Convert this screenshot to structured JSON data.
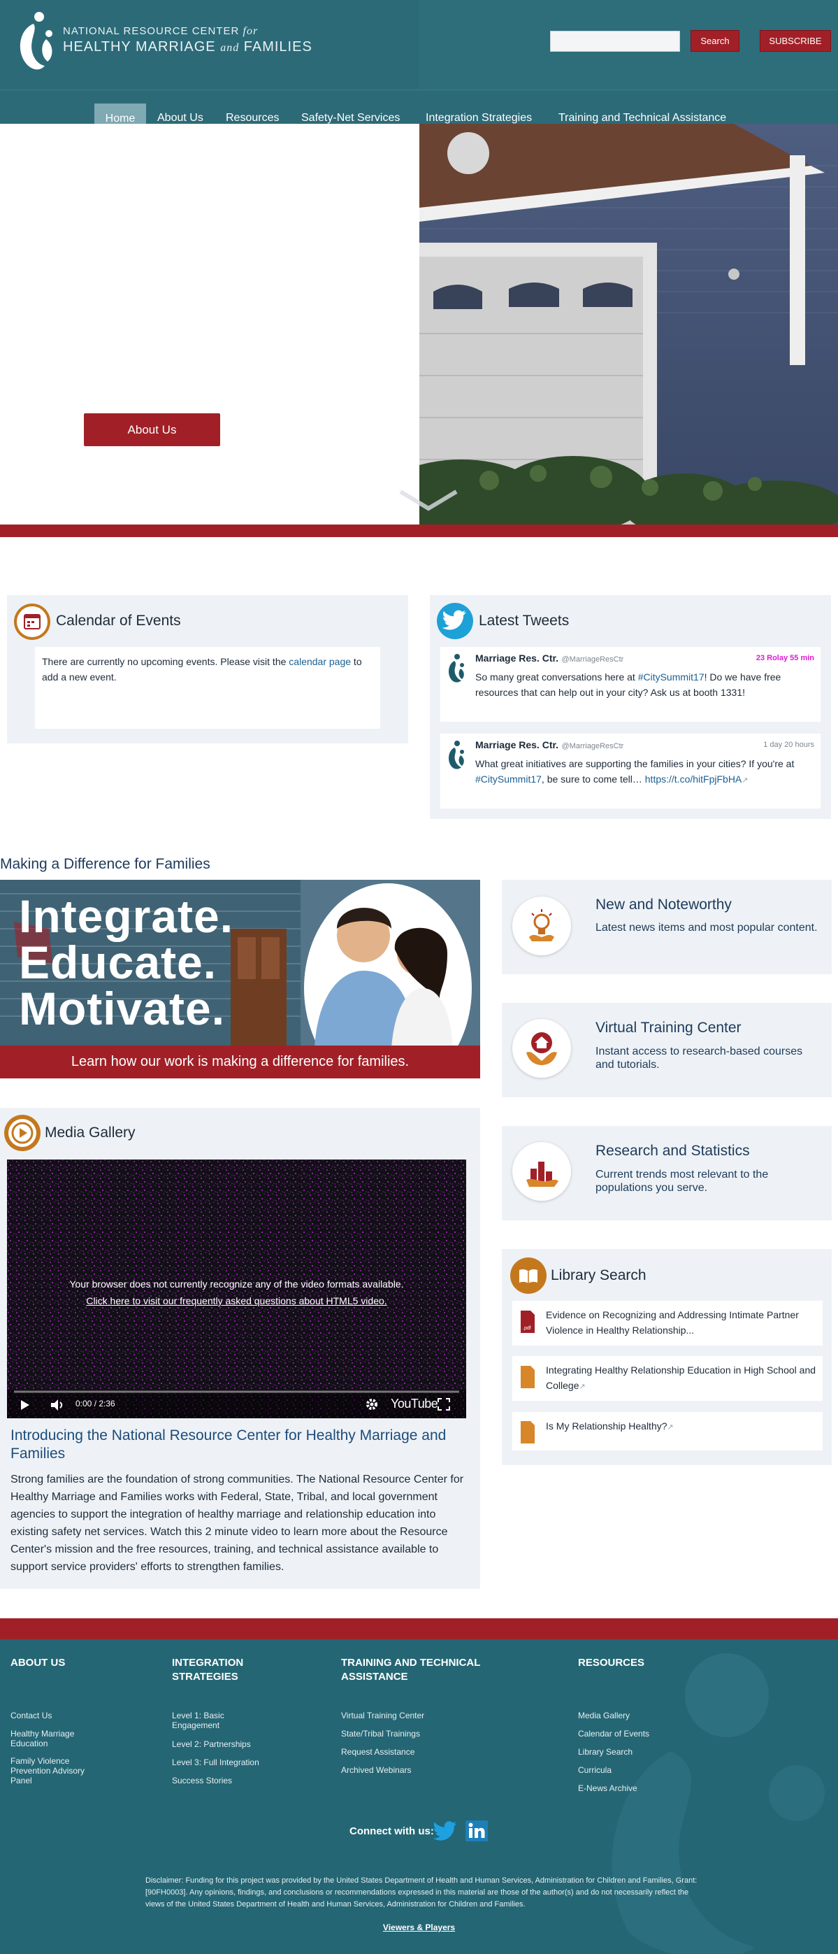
{
  "header": {
    "logo_line1": "NATIONAL RESOURCE CENTER ",
    "logo_for": "for",
    "logo_line2a": "HEALTHY MARRIAGE ",
    "logo_and": "and",
    "logo_line2b": " FAMILIES",
    "search_button": "Search",
    "subscribe_button": "SUBSCRIBE"
  },
  "nav": {
    "items": [
      "Home",
      "About Us",
      "Resources",
      "Safety-Net Services",
      "Integration Strategies",
      "Training and Technical Assistance"
    ]
  },
  "hero": {
    "button": "About Us"
  },
  "events": {
    "title": "Calendar of Events",
    "text_before": "There are currently no upcoming events. Please visit the ",
    "link": "calendar page",
    "text_after": " to add a new event."
  },
  "tweets": {
    "title": "Latest Tweets",
    "items": [
      {
        "name": "Marriage Res. Ctr.",
        "handle": "@MarriageResCtr",
        "time": "23 Rolay 55 min",
        "body_before": "So many great conversations here at ",
        "hashtag": "#CitySummit17",
        "body_after": "! Do we have free resources that can help out in your city? Ask us at booth 1331!"
      },
      {
        "name": "Marriage Res. Ctr.",
        "handle": "@MarriageResCtr",
        "time": "1 day 20 hours",
        "body_before": "What great initiatives are supporting the families in your cities? If you're at ",
        "hashtag": "#CitySummit17",
        "body_after": ", be sure to come tell… ",
        "link": "https://t.co/hitFpjFbHA"
      }
    ]
  },
  "difference": {
    "heading": "Making a Difference for Families",
    "banner_words": [
      "Integrate.",
      "Educate.",
      "Motivate."
    ],
    "banner_caption": "Learn how our work is making a difference for families."
  },
  "media": {
    "title": "Media Gallery",
    "video_msg1": "Your browser does not currently recognize any of the video formats available.",
    "video_msg2": "Click here to visit our frequently asked questions about HTML5 video.",
    "video_time": "0:00 / 2:36",
    "video_brand": "YouTube",
    "heading": "Introducing the National Resource Center for Healthy Marriage and Families",
    "description": "Strong families are the foundation of strong communities. The National Resource Center for Healthy Marriage and Families works with Federal, State, Tribal, and local government agencies to support the integration of healthy marriage and relationship education into existing safety net services. Watch this 2 minute video to learn more about the Resource Center's mission and the free resources, training, and technical assistance available to support service providers' efforts to strengthen families."
  },
  "features": [
    {
      "title": "New and Noteworthy",
      "desc": "Latest news items and most popular content."
    },
    {
      "title": "Virtual Training Center",
      "desc": "Instant access to research-based courses and tutorials."
    },
    {
      "title": "Research and Statistics",
      "desc": "Current trends most relevant to the populations you serve."
    }
  ],
  "library": {
    "title": "Library Search",
    "items": [
      "Evidence on Recognizing and Addressing Intimate Partner Violence in Healthy Relationship...",
      "Integrating Healthy Relationship Education in High School and College",
      "Is My Relationship Healthy?"
    ]
  },
  "footer": {
    "col1_title": "ABOUT US",
    "col1_links": [
      "Contact Us",
      "Healthy Marriage Education",
      "Family Violence Prevention Advisory Panel"
    ],
    "col2_title": "INTEGRATION STRATEGIES",
    "col2_links": [
      "Level 1: Basic Engagement",
      "Level 2: Partnerships",
      "Level 3: Full Integration",
      "Success Stories"
    ],
    "col3_title": "TRAINING AND TECHNICAL ASSISTANCE",
    "col3_links": [
      "Virtual Training Center",
      "State/Tribal Trainings",
      "Request Assistance",
      "Archived Webinars"
    ],
    "col4_title": "RESOURCES",
    "col4_links": [
      "Media Gallery",
      "Calendar of Events",
      "Library Search",
      "Curricula",
      "E-News Archive"
    ],
    "connect": "Connect with us:",
    "disclaimer": "Disclaimer: Funding for this project was provided by the United States Department of Health and Human Services, Administration for Children and Families, Grant: [90FH0003]. Any opinions, findings, and conclusions or recommendations expressed in this material are those of the author(s) and do not necessarily reflect the views of the United States Department of Health and Human Services, Administration for Children and Families.",
    "viewers": "Viewers & Players"
  },
  "colors": {
    "brand_teal": "#2c6a78",
    "brand_red": "#a12027",
    "panel_bg": "#eef2f6"
  }
}
